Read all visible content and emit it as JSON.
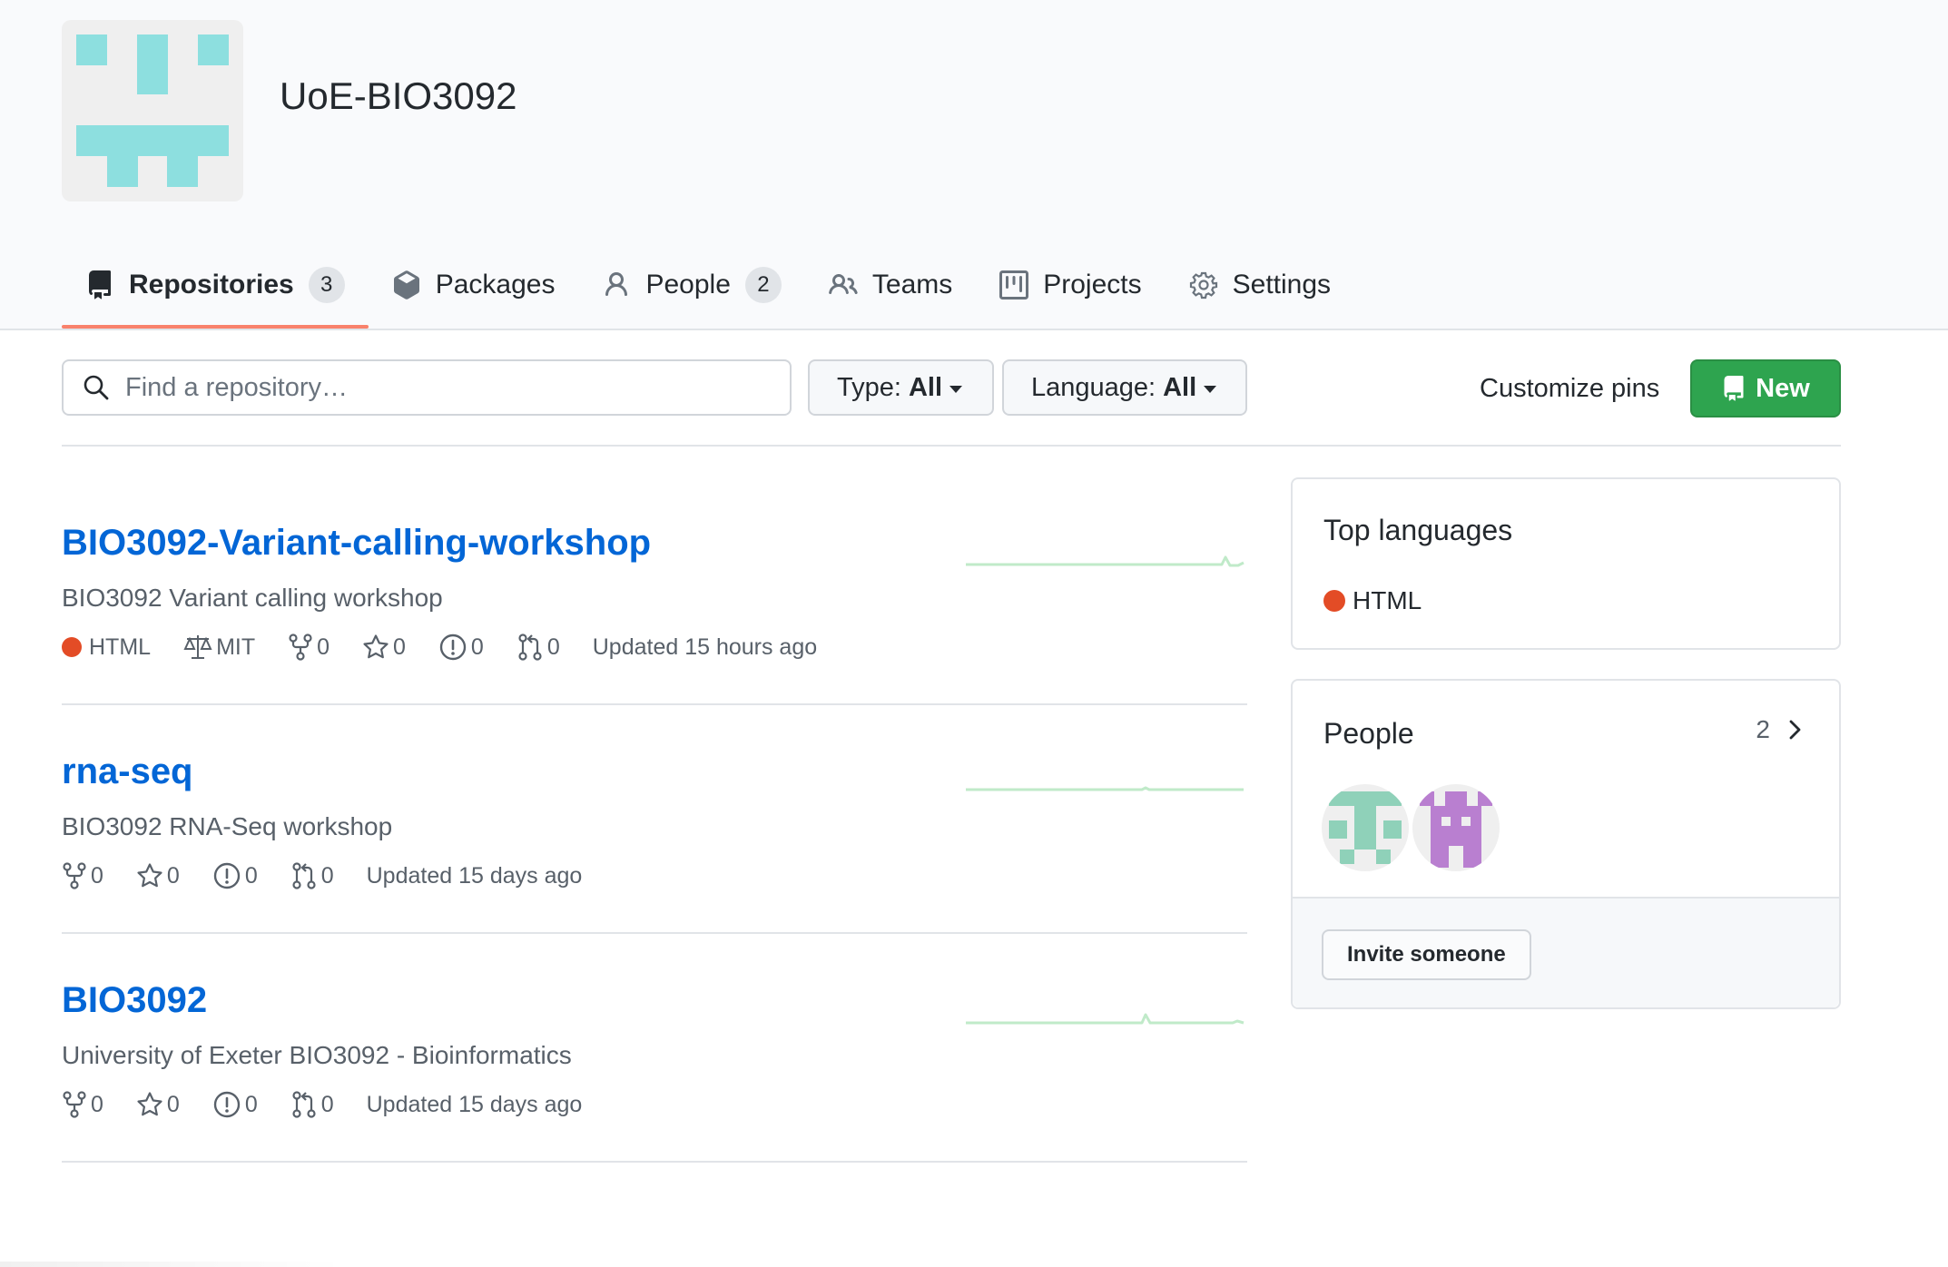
{
  "org": {
    "name": "UoE-BIO3092",
    "avatar_icon": "org-identicon"
  },
  "tabs": [
    {
      "label": "Repositories",
      "count": "3",
      "icon": "repo-icon",
      "selected": true
    },
    {
      "label": "Packages",
      "icon": "package-icon"
    },
    {
      "label": "People",
      "count": "2",
      "icon": "person-icon"
    },
    {
      "label": "Teams",
      "icon": "people-icon"
    },
    {
      "label": "Projects",
      "icon": "project-icon"
    },
    {
      "label": "Settings",
      "icon": "gear-icon"
    }
  ],
  "filters": {
    "search_placeholder": "Find a repository…",
    "type_label": "Type:",
    "type_value": "All",
    "language_label": "Language:",
    "language_value": "All",
    "customize_pins": "Customize pins",
    "new_button": "New"
  },
  "repos": [
    {
      "name": "BIO3092-Variant-calling-workshop",
      "description": "BIO3092 Variant calling workshop",
      "language": "HTML",
      "language_color": "#e34c26",
      "license": "MIT",
      "forks": "0",
      "stars": "0",
      "issues": "0",
      "pulls": "0",
      "updated": "Updated 15 hours ago"
    },
    {
      "name": "rna-seq",
      "description": "BIO3092 RNA-Seq workshop",
      "forks": "0",
      "stars": "0",
      "issues": "0",
      "pulls": "0",
      "updated": "Updated 15 days ago"
    },
    {
      "name": "BIO3092",
      "description": "University of Exeter BIO3092 - Bioinformatics",
      "forks": "0",
      "stars": "0",
      "issues": "0",
      "pulls": "0",
      "updated": "Updated 15 days ago"
    }
  ],
  "sidebar": {
    "top_languages": {
      "title": "Top languages",
      "items": [
        {
          "name": "HTML",
          "color": "#e34c26"
        }
      ]
    },
    "people": {
      "title": "People",
      "count": "2",
      "invite_button": "Invite someone"
    }
  },
  "colors": {
    "accent_link": "#0366d6",
    "new_button": "#2ea44f",
    "tab_underline": "#f9826c",
    "sparkline": "#c0eac9"
  }
}
